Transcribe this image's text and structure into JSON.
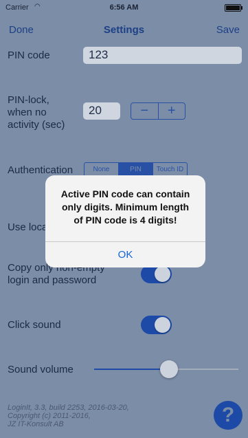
{
  "status_bar": {
    "carrier": "Carrier",
    "time": "6:56 AM"
  },
  "nav": {
    "done": "Done",
    "title": "Settings",
    "save": "Save"
  },
  "settings": {
    "pin_code_label": "PIN code",
    "pin_code_value": "123",
    "pin_lock_label_1": "PIN-lock,",
    "pin_lock_label_2": "when no",
    "pin_lock_label_3": "activity (sec)",
    "pin_lock_value": "20",
    "stepper_minus": "−",
    "stepper_plus": "+",
    "authentication_label": "Authentication",
    "auth_options": [
      "None",
      "PIN",
      "Touch ID"
    ],
    "auth_selected": "PIN",
    "use_local_label": "Use loca",
    "copy_label_1": "Copy only non-empty",
    "copy_label_2": "login and password",
    "copy_toggle_on": true,
    "click_sound_label": "Click sound",
    "click_sound_on": true,
    "sound_volume_label": "Sound volume",
    "sound_volume_fraction": 0.52
  },
  "footer": {
    "line1": "LoginIt, 3.3, build 2253, 2016-03-20,",
    "line2": "Copyright (c) 2011-2016,",
    "line3": "JZ IT-Konsult AB"
  },
  "help_label": "?",
  "alert": {
    "line1": "Active PIN code can contain",
    "line2": "only digits. Minimum length",
    "line3": "of PIN code is 4 digits!",
    "ok": "OK"
  },
  "colors": {
    "background": "#7c8da7",
    "accent": "#1d4aa6",
    "alert_button": "#1565d8"
  }
}
